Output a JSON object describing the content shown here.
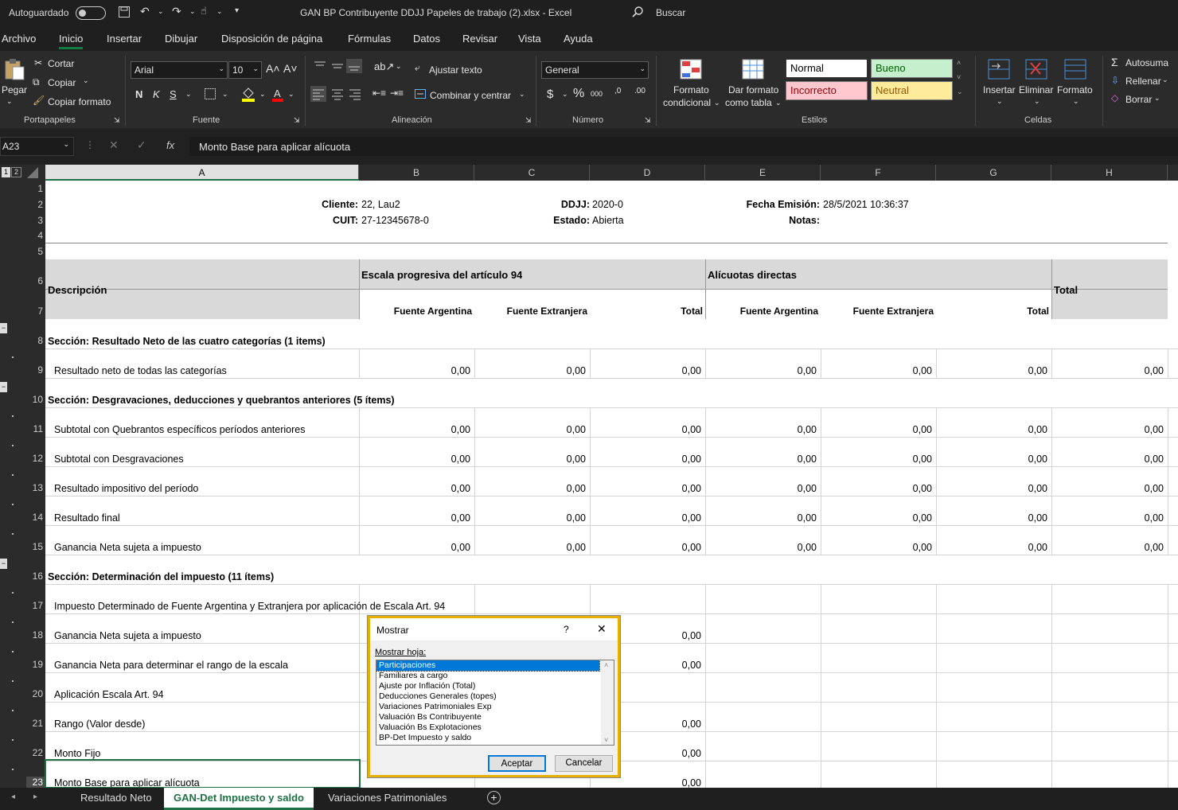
{
  "titlebar": {
    "autosave_label": "Autoguardado",
    "doc_title": "GAN BP Contribuyente DDJJ Papeles de trabajo (2).xlsx  -  Excel",
    "search_label": "Buscar"
  },
  "menu": [
    "Archivo",
    "Inicio",
    "Insertar",
    "Dibujar",
    "Disposición de página",
    "Fórmulas",
    "Datos",
    "Revisar",
    "Vista",
    "Ayuda"
  ],
  "ribbon": {
    "clipboard": {
      "paste": "Pegar",
      "cut": "Cortar",
      "copy": "Copiar",
      "format_painter": "Copiar formato",
      "label": "Portapapeles"
    },
    "font": {
      "name": "Arial",
      "size": "10",
      "bold": "N",
      "italic": "K",
      "underline": "S",
      "label": "Fuente"
    },
    "alignment": {
      "wrap": "Ajustar texto",
      "merge": "Combinar y centrar",
      "label": "Alineación"
    },
    "number": {
      "format": "General",
      "currency": "$",
      "percent": "%",
      "thousands": "000",
      "inc_dec": ",0",
      "label": "Número"
    },
    "styles": {
      "cond_format": "Formato",
      "cond_format2": "condicional",
      "as_table": "Dar formato",
      "as_table2": "como tabla",
      "normal": "Normal",
      "good": "Bueno",
      "bad": "Incorrecto",
      "neutral": "Neutral",
      "label": "Estilos"
    },
    "cells": {
      "insert": "Insertar",
      "delete": "Eliminar",
      "format": "Formato",
      "label": "Celdas"
    },
    "editing": {
      "autosum": "Autosuma",
      "fill": "Rellenar",
      "clear": "Borrar"
    }
  },
  "formula_bar": {
    "name_box": "A23",
    "fx": "fx",
    "content": "Monto Base para aplicar alícuota"
  },
  "outline_levels": [
    "1",
    "2"
  ],
  "columns": [
    "A",
    "B",
    "C",
    "D",
    "E",
    "F",
    "G",
    "H"
  ],
  "header_info": {
    "cliente_label": "Cliente:",
    "cliente_value": "22, Lau2",
    "cuit_label": "CUIT:",
    "cuit_value": "27-12345678-0",
    "ddjj_label": "DDJJ:",
    "ddjj_value": "2020-0",
    "estado_label": "Estado:",
    "estado_value": "Abierta",
    "fecha_label": "Fecha Emisión:",
    "fecha_value": "28/5/2021 10:36:37",
    "notas_label": "Notas:"
  },
  "table_header": {
    "descripcion": "Descripción",
    "escala": "Escala progresiva del artículo 94",
    "alicuotas": "Alícuotas directas",
    "total": "Total",
    "sub": [
      "Fuente Argentina",
      "Fuente Extranjera",
      "Total",
      "Fuente Argentina",
      "Fuente Extranjera",
      "Total"
    ]
  },
  "rows": [
    {
      "n": "8",
      "label": "Sección: Resultado Neto de las cuatro categorías (1 items)",
      "section": true
    },
    {
      "n": "9",
      "label": "Resultado neto de todas las categorías",
      "values": [
        "0,00",
        "0,00",
        "0,00",
        "0,00",
        "0,00",
        "0,00",
        "0,00"
      ]
    },
    {
      "n": "10",
      "label": "Sección: Desgravaciones, deducciones y quebrantos anteriores (5 ítems)",
      "section": true
    },
    {
      "n": "11",
      "label": "Subtotal con Quebrantos específicos períodos anteriores",
      "values": [
        "0,00",
        "0,00",
        "0,00",
        "0,00",
        "0,00",
        "0,00",
        "0,00"
      ]
    },
    {
      "n": "12",
      "label": "Subtotal con Desgravaciones",
      "values": [
        "0,00",
        "0,00",
        "0,00",
        "0,00",
        "0,00",
        "0,00",
        "0,00"
      ]
    },
    {
      "n": "13",
      "label": "Resultado impositivo del período",
      "values": [
        "0,00",
        "0,00",
        "0,00",
        "0,00",
        "0,00",
        "0,00",
        "0,00"
      ]
    },
    {
      "n": "14",
      "label": "Resultado final",
      "values": [
        "0,00",
        "0,00",
        "0,00",
        "0,00",
        "0,00",
        "0,00",
        "0,00"
      ]
    },
    {
      "n": "15",
      "label": "Ganancia Neta sujeta a impuesto",
      "values": [
        "0,00",
        "0,00",
        "0,00",
        "0,00",
        "0,00",
        "0,00",
        "0,00"
      ]
    },
    {
      "n": "16",
      "label": "Sección: Determinación del impuesto (11 ítems)",
      "section": true
    },
    {
      "n": "17",
      "label": "Impuesto Determinado de Fuente Argentina y Extranjera por aplicación de Escala Art. 94",
      "values": []
    },
    {
      "n": "18",
      "label": "Ganancia Neta sujeta a impuesto",
      "values": [
        "",
        "",
        "0,00"
      ]
    },
    {
      "n": "19",
      "label": "Ganancia Neta para determinar el rango de la escala",
      "values": [
        "",
        "",
        "0,00"
      ]
    },
    {
      "n": "20",
      "label": "Aplicación Escala Art. 94",
      "values": []
    },
    {
      "n": "21",
      "label": "Rango (Valor desde)",
      "values": [
        "",
        "",
        "0,00"
      ]
    },
    {
      "n": "22",
      "label": "Monto Fijo",
      "values": [
        "",
        "",
        "0,00"
      ]
    },
    {
      "n": "23",
      "label": "Monto Base para aplicar alícuota",
      "values": [
        "",
        "",
        "0,00"
      ]
    }
  ],
  "dialog": {
    "title": "Mostrar",
    "help": "?",
    "label": "Mostrar hoja:",
    "items": [
      "Participaciones",
      "Familiares a cargo",
      "Ajuste por Inflación (Total)",
      "Deducciones Generales (topes)",
      "Variaciones Patrimoniales Exp",
      "Valuación Bs Contribuyente",
      "Valuación Bs Explotaciones",
      "BP-Det Impuesto y saldo"
    ],
    "selected_index": 0,
    "ok": "Aceptar",
    "cancel": "Cancelar"
  },
  "sheet_tabs": [
    "Resultado Neto",
    "GAN-Det Impuesto y saldo",
    "Variaciones Patrimoniales"
  ],
  "active_tab": 1,
  "colors": {
    "accent": "#1e7145",
    "dialog_highlight": "#e5b000",
    "header_fill": "#d9d9d9",
    "good_fill": "#c6efce",
    "bad_fill": "#ffc7ce",
    "neutral_fill": "#ffeb9c"
  }
}
